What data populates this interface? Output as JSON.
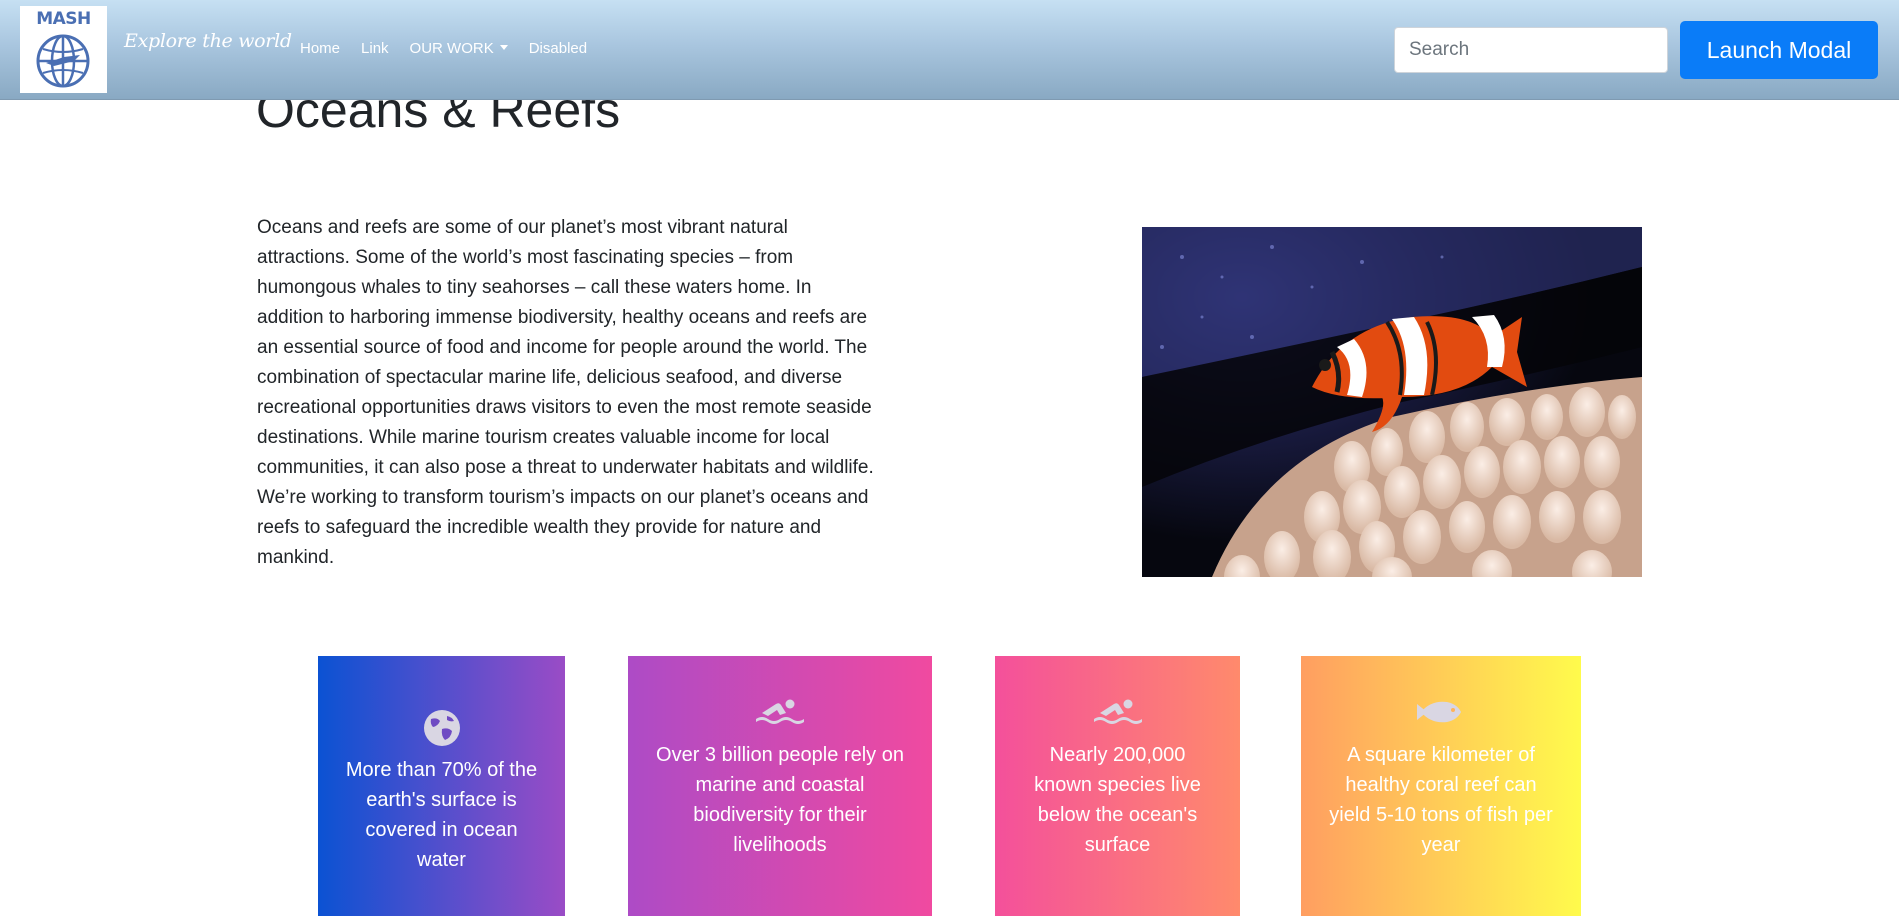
{
  "navbar": {
    "logo_text": "MASH",
    "tagline": "Explore the world",
    "links": [
      {
        "label": "Home"
      },
      {
        "label": "Link"
      },
      {
        "label": "OUR WORK"
      },
      {
        "label": "Disabled"
      }
    ],
    "search_placeholder": "Search",
    "modal_button_label": "Launch Modal"
  },
  "main": {
    "title": "Oceans & Reefs",
    "intro": "Oceans and reefs are some of our planet’s most vibrant natural attractions. Some of the world’s most fascinating species – from humongous whales to tiny seahorses – call these waters home. In addition to harboring immense biodiversity, healthy oceans and reefs are an essential source of food and income for people around the world. The combination of spectacular marine life, delicious seafood, and diverse recreational opportunities draws visitors to even the most remote seaside destinations. While marine tourism creates valuable income for local communities, it can also pose a threat to underwater habitats and wildlife. We’re working to transform tourism’s impacts on our planet’s oceans and reefs to safeguard the incredible wealth they provide for nature and mankind.",
    "image_icon": "clownfish-anemone-photo"
  },
  "cards": [
    {
      "icon": "globe-icon",
      "text": "More than 70% of the earth's surface is covered in ocean water"
    },
    {
      "icon": "swimmer-icon",
      "text": "Over 3 billion people rely on marine and coastal biodiversity for their livelihoods"
    },
    {
      "icon": "swimmer-icon",
      "text": "Nearly 200,000 known species live below the ocean's surface"
    },
    {
      "icon": "fish-icon",
      "text": "A square kilometer of healthy coral reef can yield 5-10 tons of fish per year"
    }
  ],
  "colors": {
    "accent": "#0a7cf8",
    "icon_tint": "#d9d6e3"
  }
}
